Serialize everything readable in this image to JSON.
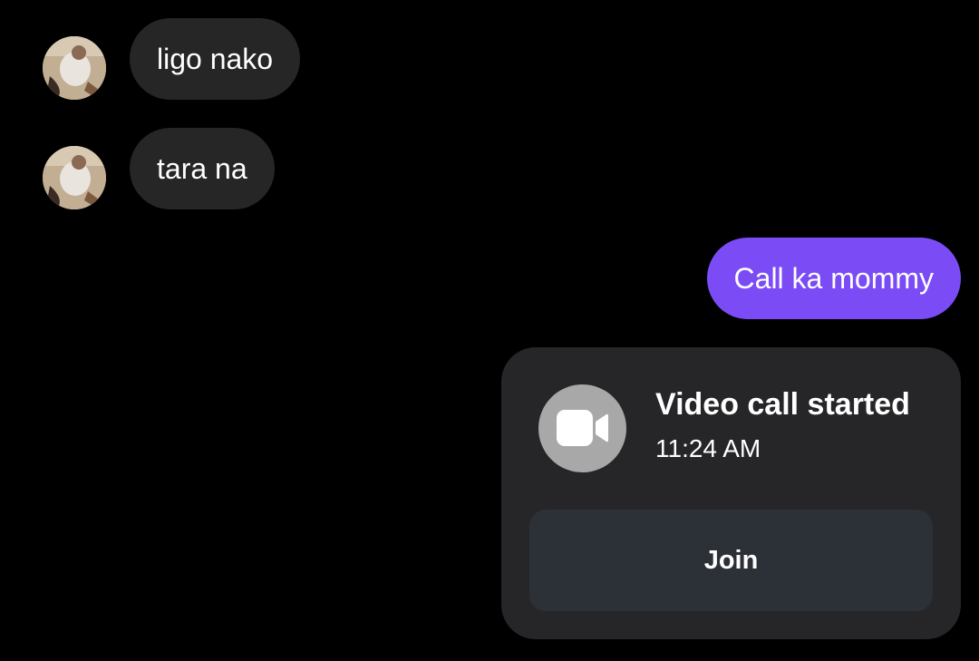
{
  "conversation": {
    "messages": [
      {
        "direction": "incoming",
        "text": "ligo nako"
      },
      {
        "direction": "incoming",
        "text": "tara na"
      },
      {
        "direction": "outgoing",
        "text": "Call ka mommy"
      }
    ],
    "call_card": {
      "icon": "video-camera-icon",
      "title": "Video call started",
      "time": "11:24 AM",
      "join_label": "Join"
    }
  },
  "colors": {
    "background": "#000000",
    "incoming_bubble": "#262626",
    "outgoing_bubble": "#7b4cf6",
    "card_background": "#262629",
    "join_button": "#2c3037",
    "icon_circle": "#a8a8a8"
  }
}
